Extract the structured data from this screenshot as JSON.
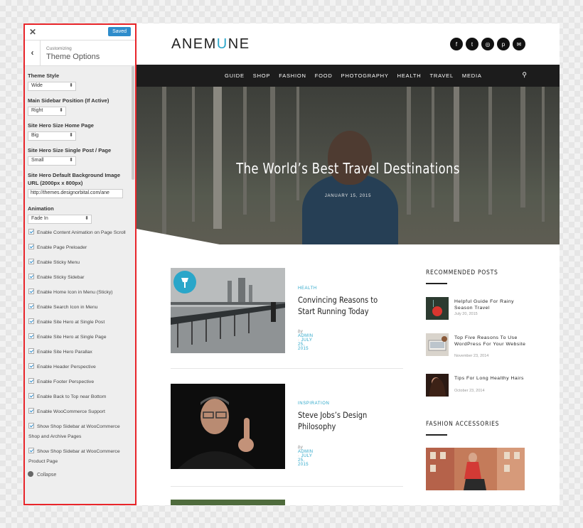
{
  "customizer": {
    "close_icon": "close-icon",
    "saved_label": "Saved",
    "subtitle": "Customizing",
    "title": "Theme Options",
    "settings": {
      "theme_style": {
        "label": "Theme Style",
        "value": "Wide"
      },
      "sidebar_position": {
        "label": "Main Sidebar Position (If Active)",
        "value": "Right"
      },
      "hero_home": {
        "label": "Site Hero Size Home Page",
        "value": "Big"
      },
      "hero_single": {
        "label": "Site Hero Size Single Post / Page",
        "value": "Small"
      },
      "hero_bg": {
        "label": "Site Hero Default Background Image URL (2000px x 800px)",
        "value": "http://themes.designorbital.com/ane"
      },
      "animation": {
        "label": "Animation",
        "value": "Fade In"
      }
    },
    "checkboxes": [
      "Enable Content Animation on Page Scroll",
      "Enable Page Preloader",
      "Enable Sticky Menu",
      "Enable Sticky Sidebar",
      "Enable Home Icon in Menu (Sticky)",
      "Enable Search Icon in Menu",
      "Enable Site Hero at Single Post",
      "Enable Site Hero at Single Page",
      "Enable Site Hero Parallax",
      "Enable Header Perspective",
      "Enable Footer Perspective",
      "Enable Back to Top near Bottom",
      "Enable WooCommerce Support",
      "Show Shop Sidebar at WooCommerce Shop and Archive Pages",
      "Show Shop Sidebar at WooCommerce Product Page"
    ],
    "collapse_label": "Collapse"
  },
  "site": {
    "logo_prefix": "ANEM",
    "logo_mid": "U",
    "logo_suffix": "NE",
    "social_icons": [
      "facebook-icon",
      "twitter-icon",
      "instagram-icon",
      "pinterest-icon",
      "mail-icon"
    ],
    "social_glyphs": [
      "f",
      "t",
      "◎",
      "p",
      "✉"
    ],
    "nav": [
      "GUIDE",
      "SHOP",
      "FASHION",
      "FOOD",
      "PHOTOGRAPHY",
      "HEALTH",
      "TRAVEL",
      "MEDIA"
    ],
    "hero": {
      "title": "The World’s Best Travel Destinations",
      "date": "JANUARY 15, 2015"
    },
    "posts": [
      {
        "category": "HEALTH",
        "title": "Convincing Reasons to Start Running Today",
        "by": "by",
        "author": "ADMIN",
        "date": "JULY 25, 2015"
      },
      {
        "category": "INSPIRATION",
        "title": "Steve Jobs’s Design Philosophy",
        "by": "by",
        "author": "ADMIN",
        "date": "JULY 25, 2015"
      }
    ],
    "sidebar": {
      "recommended_title": "RECOMMENDED POSTS",
      "recommended": [
        {
          "title": "Helpful Guide For Rainy Season Travel",
          "date": "July 20, 2015"
        },
        {
          "title": "Top Five Reasons To Use WordPress For Your Website",
          "date": "November 23, 2014"
        },
        {
          "title": "Tips For Long Healthy Hairs",
          "date": "October 23, 2014"
        }
      ],
      "fashion_title": "FASHION ACCESSORIES"
    }
  },
  "colors": {
    "accent": "#2aa6c9",
    "highlight_border": "#e8252a",
    "saved_button": "#2e8ccb",
    "nav_bg": "#1c1c1c"
  }
}
